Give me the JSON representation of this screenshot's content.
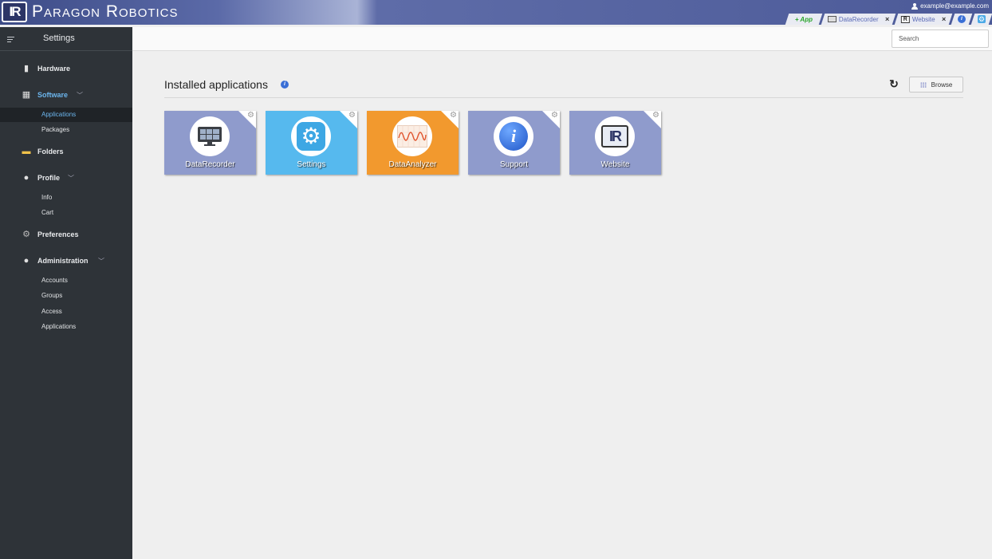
{
  "topbar": {
    "logo_mark": "IR",
    "brand": "Paragon Robotics",
    "user_email": "example@example.com",
    "tabs": [
      {
        "kind": "add",
        "label": "+ App"
      },
      {
        "kind": "app",
        "label": "DataRecorder",
        "close": "×"
      },
      {
        "kind": "app",
        "label": "Website",
        "close": "×"
      },
      {
        "kind": "icon",
        "icon": "info-icon"
      },
      {
        "kind": "icon",
        "icon": "settings-icon"
      }
    ]
  },
  "sidebar": {
    "title": "Settings",
    "sections": [
      {
        "label": "Hardware",
        "icon": "hardware-icon"
      },
      {
        "label": "Software",
        "icon": "grid-icon",
        "active": true,
        "items": [
          "Applications",
          "Packages"
        ],
        "selected": "Applications"
      },
      {
        "label": "Folders",
        "icon": "folder-icon"
      },
      {
        "label": "Profile",
        "icon": "user-icon",
        "items": [
          "Info",
          "Cart"
        ]
      },
      {
        "label": "Preferences",
        "icon": "gear-icon"
      },
      {
        "label": "Administration",
        "icon": "admin-icon",
        "items": [
          "Accounts",
          "Groups",
          "Access",
          "Applications"
        ]
      }
    ]
  },
  "header": {
    "search_placeholder": "Search"
  },
  "main": {
    "title": "Installed applications",
    "info_glyph": "i",
    "browse_label": "Browse",
    "apps": [
      {
        "name": "DataRecorder",
        "color": "#8f9bcc",
        "icon": "monitor-icon"
      },
      {
        "name": "Settings",
        "color": "#56b9ee",
        "icon": "settings-gear-icon"
      },
      {
        "name": "DataAnalyzer",
        "color": "#f2992e",
        "icon": "waveform-icon"
      },
      {
        "name": "Support",
        "color": "#8f9bcc",
        "icon": "info-icon"
      },
      {
        "name": "Website",
        "color": "#8f9bcc",
        "icon": "ir-logo-icon"
      }
    ]
  }
}
